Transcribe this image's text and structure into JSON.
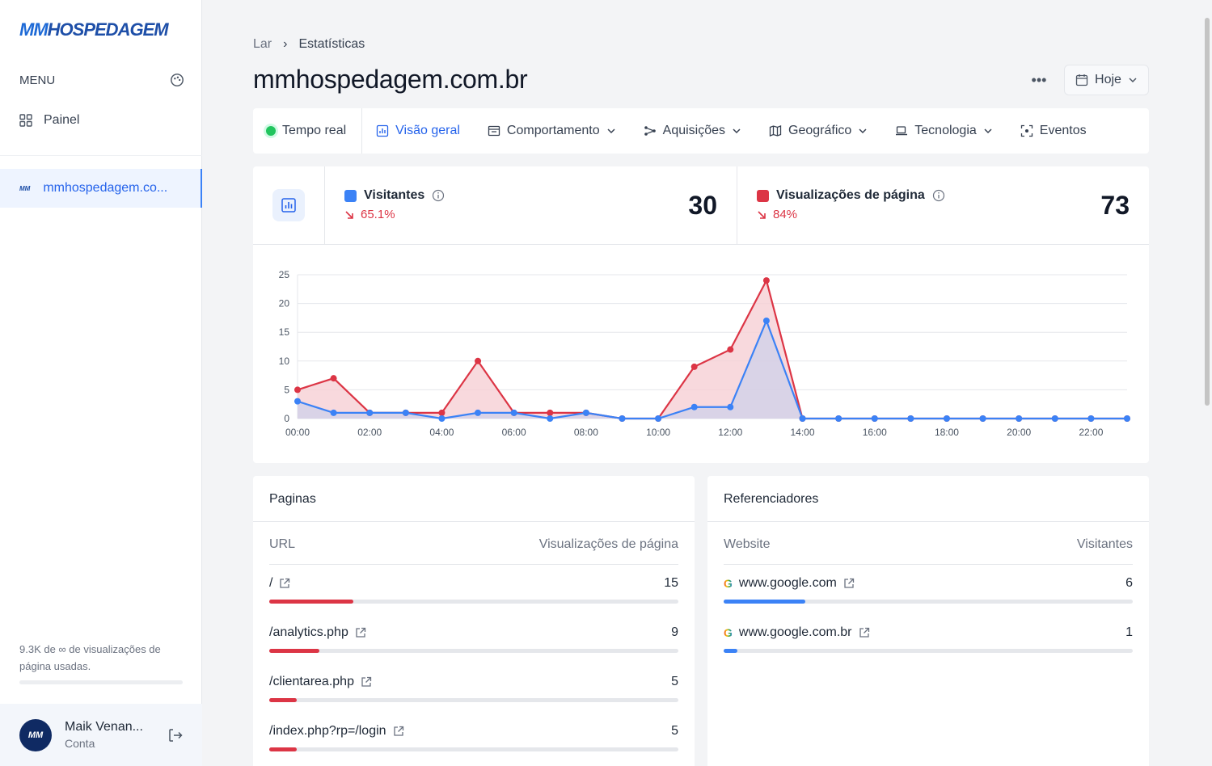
{
  "brand": {
    "logo_mm": "MM",
    "logo_text": "HOSPEDAGEM",
    "mini_logo": "MM"
  },
  "sidebar": {
    "menu_label": "MENU",
    "nav": [
      {
        "label": "Painel",
        "icon": "grid-icon"
      }
    ],
    "site_label": "mmhospedagem.co...",
    "usage_text": "9.3K de ∞ de visualizações de página usadas.",
    "usage_fraction": 0.0,
    "account": {
      "name": "Maik Venan...",
      "sub": "Conta",
      "avatar": "MM"
    }
  },
  "breadcrumb": {
    "root": "Lar",
    "current": "Estatísticas"
  },
  "page_title": "mmhospedagem.com.br",
  "header": {
    "more": "•••",
    "date_label": "Hoje"
  },
  "tabs": [
    {
      "label": "Tempo real",
      "icon": "live-dot-icon"
    },
    {
      "label": "Visão geral",
      "icon": "bar-chart-icon",
      "active": true
    },
    {
      "label": "Comportamento",
      "icon": "window-icon",
      "dropdown": true
    },
    {
      "label": "Aquisições",
      "icon": "share-icon",
      "dropdown": true
    },
    {
      "label": "Geográfico",
      "icon": "map-icon",
      "dropdown": true
    },
    {
      "label": "Tecnologia",
      "icon": "devices-icon",
      "dropdown": true
    },
    {
      "label": "Eventos",
      "icon": "target-icon"
    }
  ],
  "stats": {
    "visitors": {
      "label": "Visitantes",
      "change": "65.1%",
      "value": "30",
      "color": "#3b82f6"
    },
    "pageviews": {
      "label": "Visualizações de página",
      "change": "84%",
      "value": "73",
      "color": "#dc3545"
    }
  },
  "chart_data": {
    "type": "area",
    "x": [
      "00:00",
      "01:00",
      "02:00",
      "03:00",
      "04:00",
      "05:00",
      "06:00",
      "07:00",
      "08:00",
      "09:00",
      "10:00",
      "11:00",
      "12:00",
      "13:00",
      "14:00",
      "15:00",
      "16:00",
      "17:00",
      "18:00",
      "19:00",
      "20:00",
      "21:00",
      "22:00",
      "23:00"
    ],
    "tick_labels": [
      "00:00",
      "02:00",
      "04:00",
      "06:00",
      "08:00",
      "10:00",
      "12:00",
      "14:00",
      "16:00",
      "18:00",
      "20:00",
      "22:00"
    ],
    "y_ticks": [
      "0",
      "5",
      "10",
      "15",
      "20",
      "25"
    ],
    "ylim": [
      0,
      25
    ],
    "series": [
      {
        "name": "Visualizações de página",
        "color": "#dc3545",
        "fill": "#f6d0d4",
        "values": [
          5,
          7,
          1,
          1,
          1,
          10,
          1,
          1,
          1,
          0,
          0,
          9,
          12,
          24,
          0,
          0,
          0,
          0,
          0,
          0,
          0,
          0,
          0,
          0
        ]
      },
      {
        "name": "Visitantes",
        "color": "#3b82f6",
        "fill": "#cfd0ea",
        "values": [
          3,
          1,
          1,
          1,
          0,
          1,
          1,
          0,
          1,
          0,
          0,
          2,
          2,
          17,
          0,
          0,
          0,
          0,
          0,
          0,
          0,
          0,
          0,
          0
        ]
      }
    ],
    "grid": true
  },
  "pages": {
    "title": "Paginas",
    "col_left": "URL",
    "col_right": "Visualizações de página",
    "color": "#dc3545",
    "rows": [
      {
        "label": "/",
        "value": "15",
        "fraction": 0.206
      },
      {
        "label": "/analytics.php",
        "value": "9",
        "fraction": 0.123
      },
      {
        "label": "/clientarea.php",
        "value": "5",
        "fraction": 0.068
      },
      {
        "label": "/index.php?rp=/login",
        "value": "5",
        "fraction": 0.068
      }
    ]
  },
  "referrers": {
    "title": "Referenciadores",
    "col_left": "Website",
    "col_right": "Visitantes",
    "color": "#3b82f6",
    "rows": [
      {
        "label": "www.google.com",
        "value": "6",
        "fraction": 0.2
      },
      {
        "label": "www.google.com.br",
        "value": "1",
        "fraction": 0.033
      }
    ]
  }
}
